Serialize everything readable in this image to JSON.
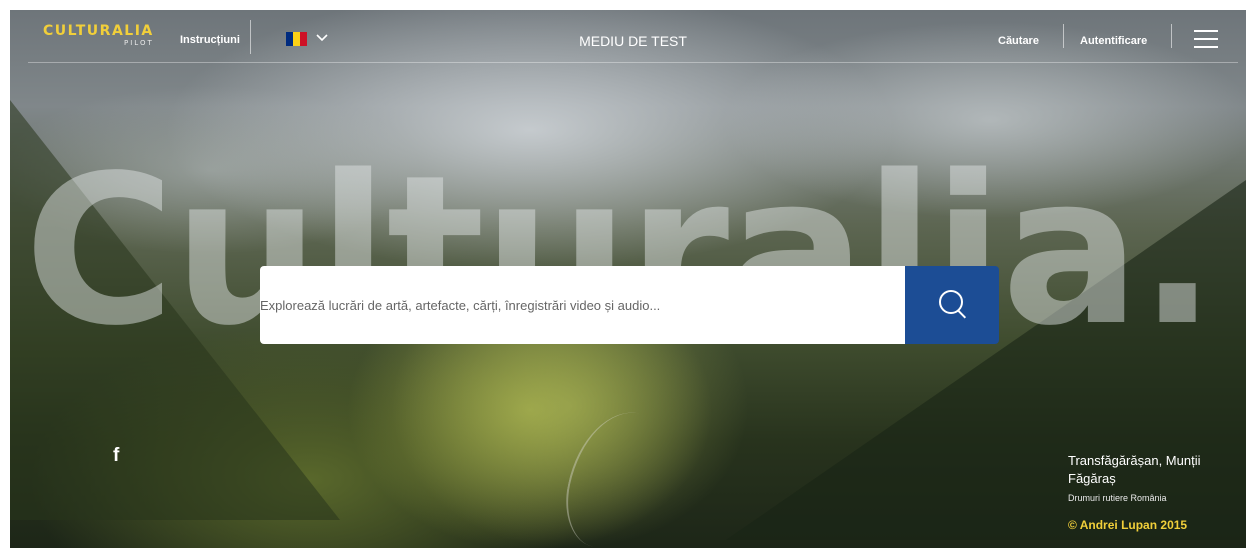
{
  "header": {
    "logo": {
      "name": "CULTURALIA",
      "sub": "PILOT"
    },
    "instructions_label": "Instrucțiuni",
    "language": {
      "selected": "Română",
      "flag_colors": [
        "#002b7f",
        "#fcd116",
        "#ce1126"
      ]
    },
    "environment_label": "MEDIU DE TEST",
    "search_label": "Căutare",
    "login_label": "Autentificare"
  },
  "hero": {
    "watermark": "Culturalia.",
    "search_placeholder": "Explorează lucrări de artă, artefacte, cărți, înregistrări video și audio..."
  },
  "social": {
    "facebook": "f"
  },
  "caption": {
    "title": "Transfăgărășan, Munții Făgăraș",
    "subtitle": "Drumuri rutiere România",
    "credit": "© Andrei Lupan 2015"
  },
  "colors": {
    "brand_yellow": "#f1cf3a",
    "search_button": "#1c4d95"
  }
}
